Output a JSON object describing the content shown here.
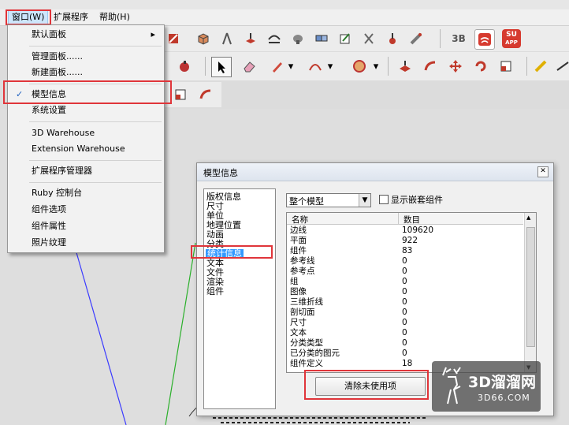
{
  "menubar": {
    "window": "窗口(W)",
    "extensions": "扩展程序",
    "help": "帮助(H)"
  },
  "window_menu": {
    "items": [
      {
        "label": "默认面板",
        "submenu": true
      },
      {
        "label": "管理面板......"
      },
      {
        "label": "新建面板......"
      },
      {
        "label": "模型信息",
        "checked": true
      },
      {
        "label": "系统设置"
      },
      {
        "label": "3D Warehouse"
      },
      {
        "label": "Extension Warehouse"
      },
      {
        "label": "扩展程序管理器"
      },
      {
        "label": "Ruby 控制台"
      },
      {
        "label": "组件选项"
      },
      {
        "label": "组件属性"
      },
      {
        "label": "照片纹理"
      }
    ]
  },
  "toolbar": {
    "badge_3b": "3B",
    "badge_su": "SU",
    "badge_app": "APP"
  },
  "dialog": {
    "title": "模型信息",
    "categories": [
      "版权信息",
      "尺寸",
      "单位",
      "地理位置",
      "动画",
      "分类",
      "统计信息",
      "文本",
      "文件",
      "渲染",
      "组件"
    ],
    "selected_category": "统计信息",
    "scope_select": "整个模型",
    "show_nested_label": "显示嵌套组件",
    "table": {
      "col_name": "名称",
      "col_count": "数目",
      "rows": [
        {
          "name": "边线",
          "count": "109620"
        },
        {
          "name": "平面",
          "count": "922"
        },
        {
          "name": "组件",
          "count": "83"
        },
        {
          "name": "参考线",
          "count": "0"
        },
        {
          "name": "参考点",
          "count": "0"
        },
        {
          "name": "组",
          "count": "0"
        },
        {
          "name": "图像",
          "count": "0"
        },
        {
          "name": "三维折线",
          "count": "0"
        },
        {
          "name": "剖切面",
          "count": "0"
        },
        {
          "name": "尺寸",
          "count": "0"
        },
        {
          "name": "文本",
          "count": "0"
        },
        {
          "name": "分类类型",
          "count": "0"
        },
        {
          "name": "已分类的图元",
          "count": "0"
        },
        {
          "name": "组件定义",
          "count": "18"
        }
      ]
    },
    "purge_button": "清除未使用项"
  },
  "watermark": {
    "brand": "3D溜溜网",
    "url": "3D66.COM"
  },
  "colors": {
    "highlight_red": "#e0353a",
    "menu_bg": "#f2f2f2",
    "selection_blue": "#3399ff"
  }
}
